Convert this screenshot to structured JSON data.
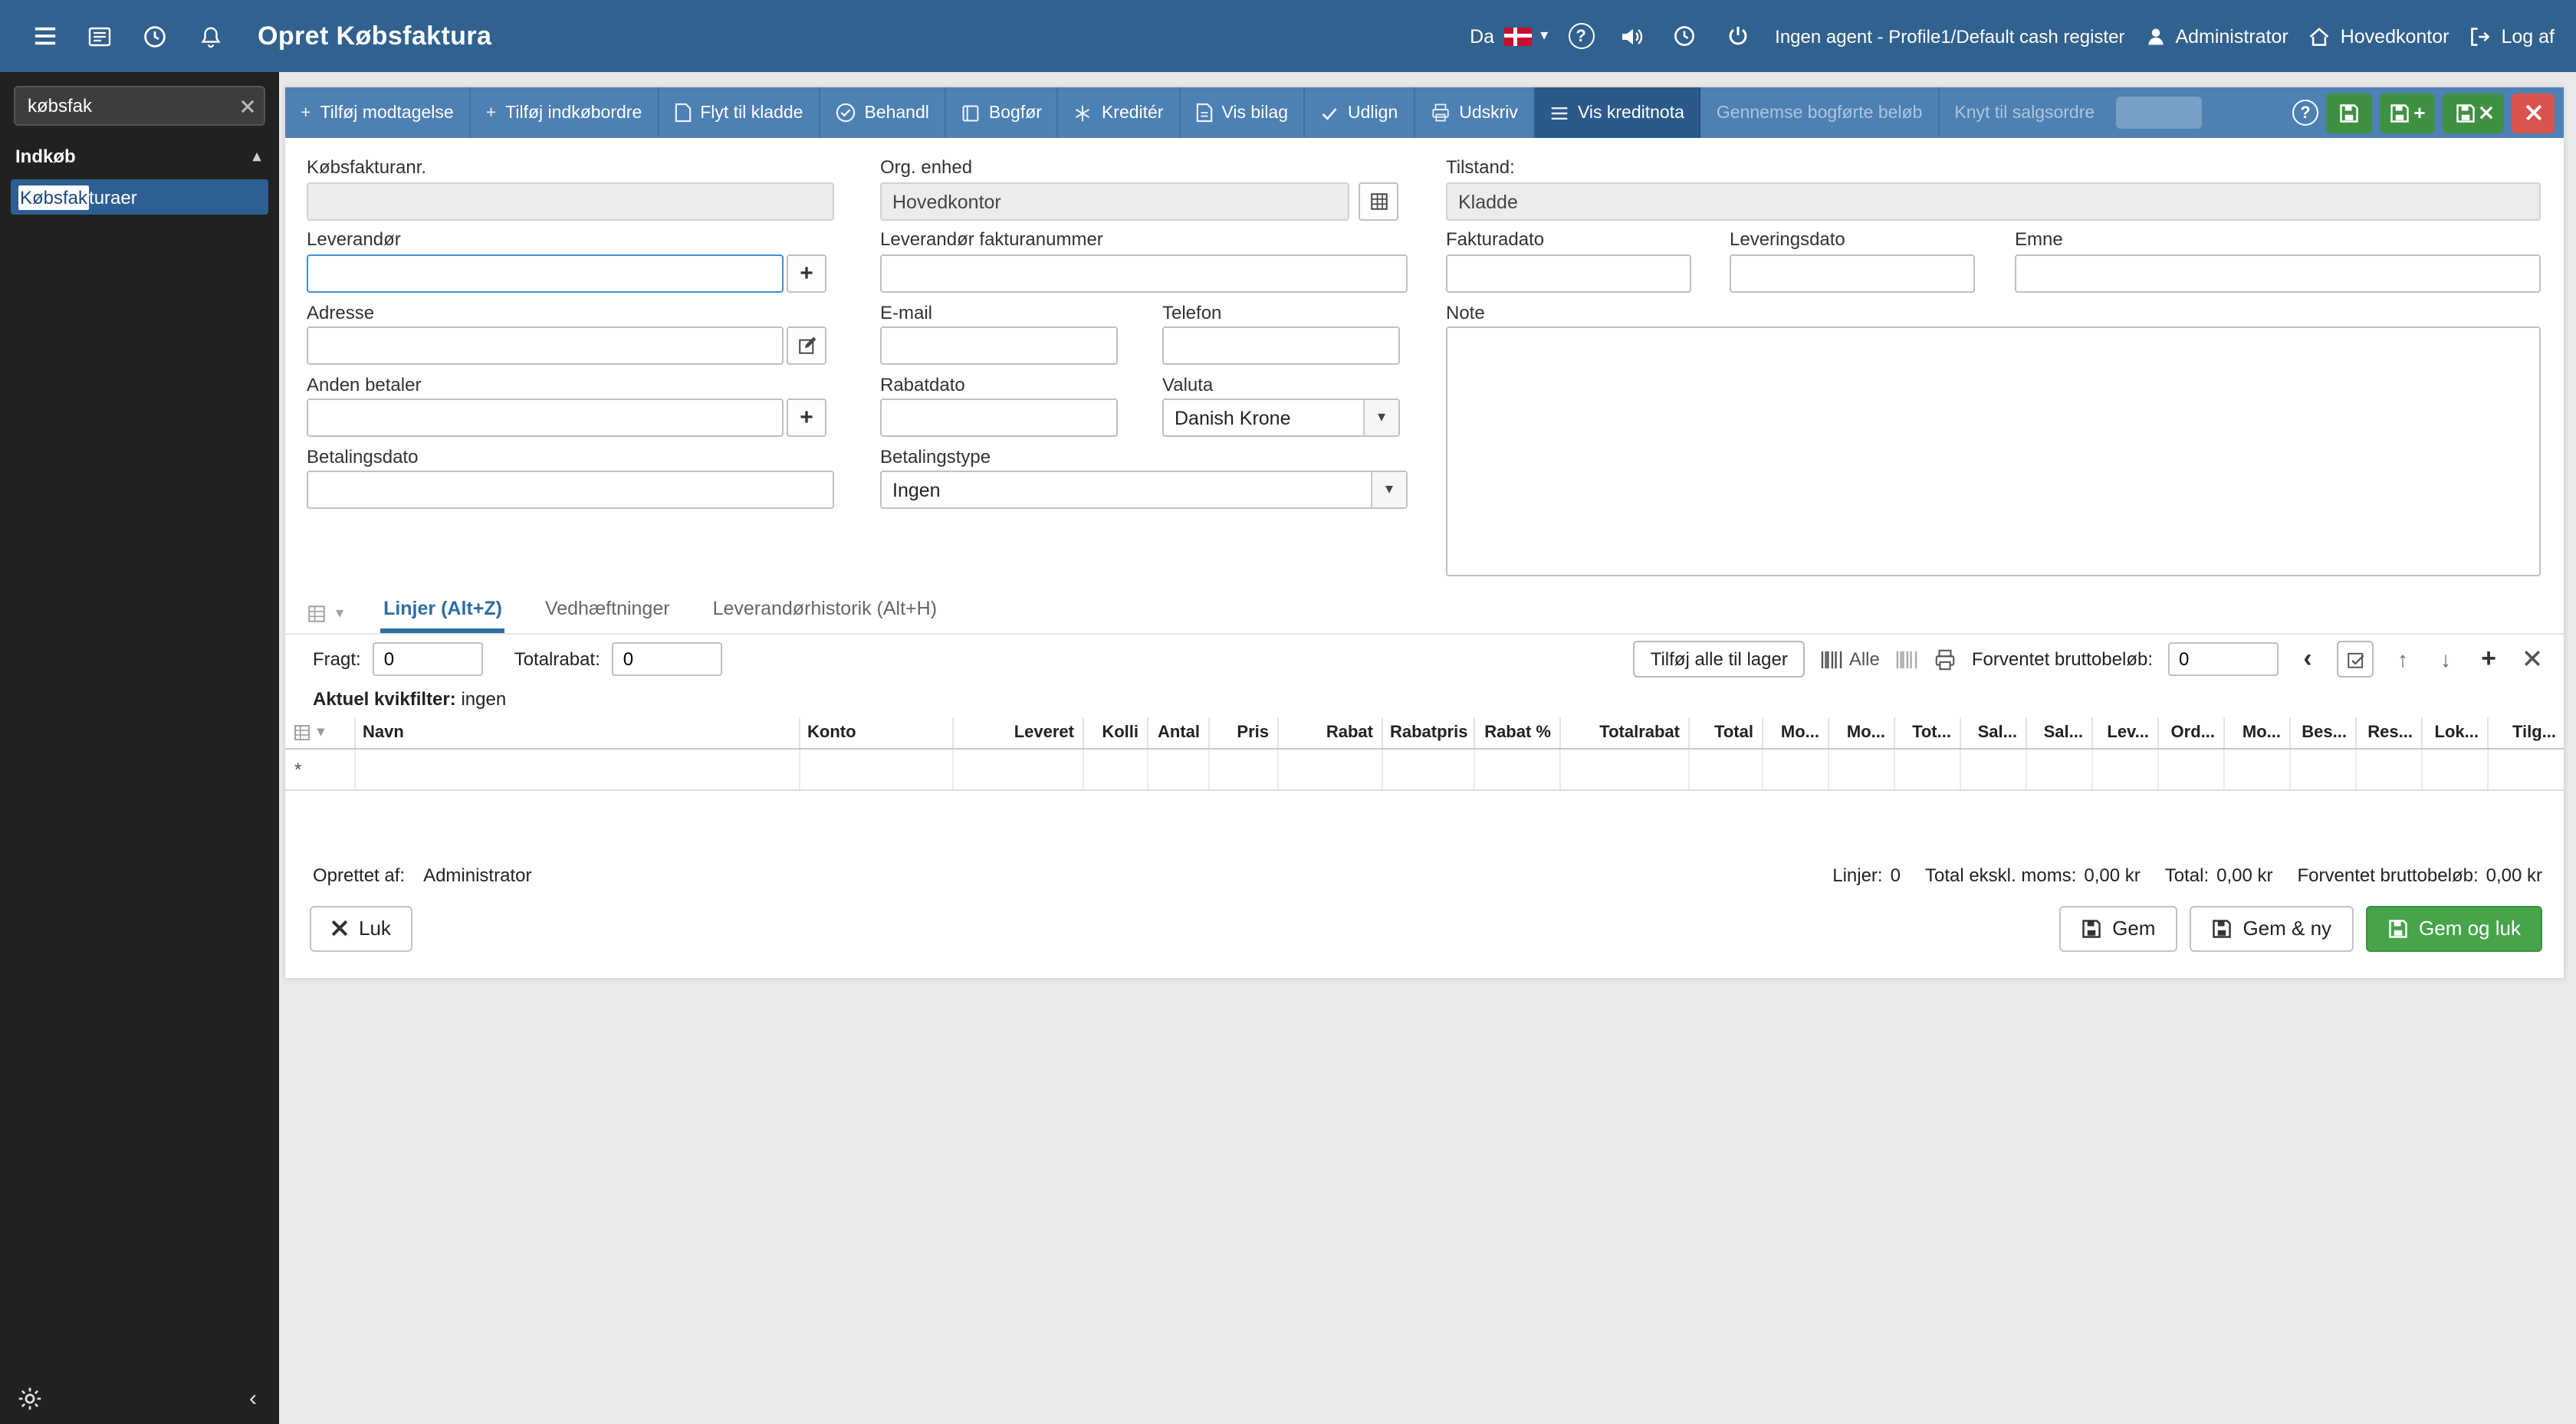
{
  "colors": {
    "topbar_blue": "#31618e",
    "toolbar_blue": "#4d80b3",
    "toolbar_active_blue": "#2b5a8a",
    "sidebar_dark": "#212121",
    "selected_item_blue": "#2e5f93",
    "save_green": "#3f9142",
    "primary_green": "#47a44b",
    "close_red": "#d9534f"
  },
  "icons": {
    "caret_down": "▾",
    "chevron_up": "▴",
    "chevron_left": "‹",
    "nav_prev": "‹",
    "arrow_up": "↑",
    "arrow_down": "↓",
    "plus": "+",
    "question": "?"
  },
  "topbar": {
    "title": "Opret Købsfaktura",
    "language": "Da",
    "status_text": "Ingen agent - Profile1/Default cash register",
    "user": "Administrator",
    "location": "Hovedkontor",
    "logout_label": "Log af"
  },
  "sidebar": {
    "search_value": "købsfak",
    "section_label": "Indkøb",
    "item_match": "Købsfak",
    "item_rest": "turaer"
  },
  "toolbar": {
    "buttons": [
      {
        "label": "Tilføj modtagelse"
      },
      {
        "label": "Tilføj indkøbordre"
      },
      {
        "label": "Flyt til kladde"
      },
      {
        "label": "Behandl"
      },
      {
        "label": "Bogfør"
      },
      {
        "label": "Kreditér"
      },
      {
        "label": "Vis bilag"
      },
      {
        "label": "Udlign"
      },
      {
        "label": "Udskriv"
      },
      {
        "label": "Vis kreditnota"
      },
      {
        "label": "Gennemse bogførte beløb"
      },
      {
        "label": "Knyt til salgsordre"
      }
    ]
  },
  "form": {
    "kobsfakturanr_label": "Købsfakturanr.",
    "org_enhed_label": "Org. enhed",
    "org_enhed_value": "Hovedkontor",
    "tilstand_label": "Tilstand:",
    "tilstand_value": "Kladde",
    "leverandor_label": "Leverandør",
    "lev_fakturanr_label": "Leverandør fakturanummer",
    "fakturadato_label": "Fakturadato",
    "leveringsdato_label": "Leveringsdato",
    "emne_label": "Emne",
    "adresse_label": "Adresse",
    "email_label": "E-mail",
    "telefon_label": "Telefon",
    "note_label": "Note",
    "anden_betaler_label": "Anden betaler",
    "rabatdato_label": "Rabatdato",
    "valuta_label": "Valuta",
    "valuta_value": "Danish Krone",
    "betalingsdato_label": "Betalingsdato",
    "betalingstype_label": "Betalingstype",
    "betalingstype_value": "Ingen"
  },
  "tabs": [
    {
      "label": "Linjer (Alt+Z)"
    },
    {
      "label": "Vedhæftninger"
    },
    {
      "label": "Leverandørhistorik (Alt+H)"
    }
  ],
  "lines_toolbar": {
    "fragt_label": "Fragt:",
    "fragt_value": "0",
    "totalrabat_label": "Totalrabat:",
    "totalrabat_value": "0",
    "add_all_label": "Tilføj alle til lager",
    "alle_label": "Alle",
    "forventet_label": "Forventet bruttobeløb:",
    "forventet_value": "0"
  },
  "quickfilter": {
    "label": "Aktuel kvikfilter:",
    "value": "ingen"
  },
  "table": {
    "columns": [
      "Navn",
      "Konto",
      "Leveret",
      "Kolli",
      "Antal",
      "Pris",
      "Rabat",
      "Rabatpris",
      "Rabat %",
      "Totalrabat",
      "Total",
      "Mo...",
      "Mo...",
      "Tot...",
      "Sal...",
      "Sal...",
      "Lev...",
      "Ord...",
      "Mo...",
      "Bes...",
      "Res...",
      "Lok...",
      "Tilg..."
    ],
    "new_row_marker": "*"
  },
  "footer": {
    "oprettet_label": "Oprettet af:",
    "oprettet_value": "Administrator",
    "linjer_label": "Linjer:",
    "linjer_value": "0",
    "ekskl_label": "Total ekskl. moms:",
    "ekskl_value": "0,00 kr",
    "total_label": "Total:",
    "total_value": "0,00 kr",
    "forventet_label": "Forventet bruttobeløb:",
    "forventet_value": "0,00 kr"
  },
  "actions": {
    "luk": "Luk",
    "gem": "Gem",
    "gem_ny": "Gem & ny",
    "gem_luk": "Gem og luk"
  }
}
